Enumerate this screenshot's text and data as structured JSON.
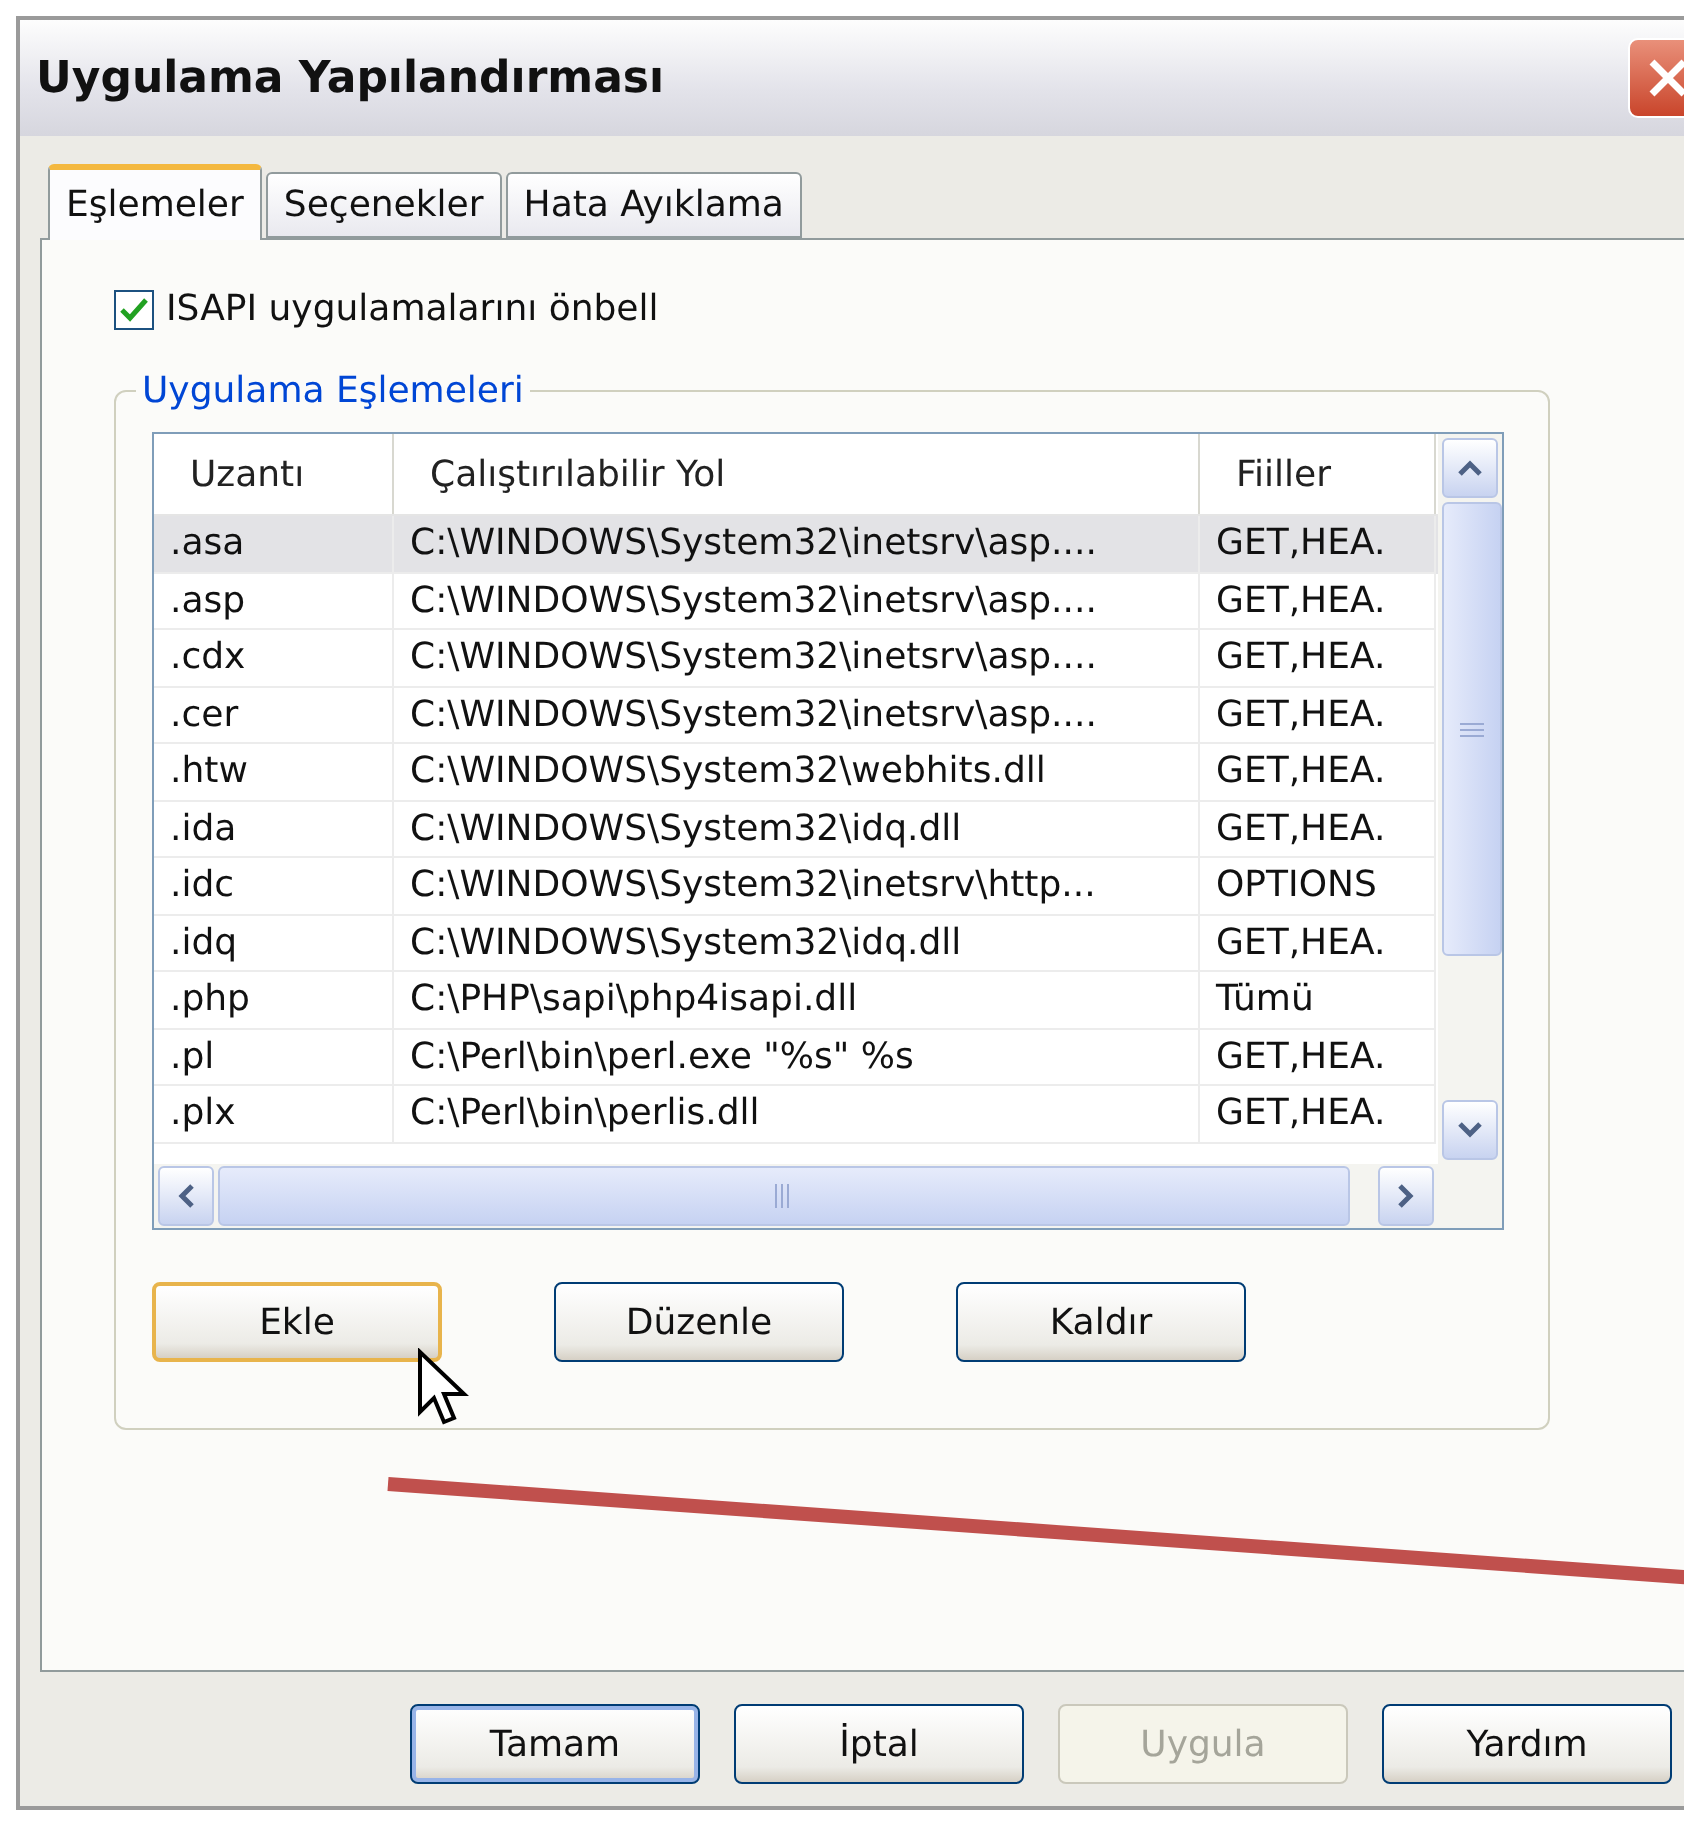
{
  "window": {
    "title": "Uygulama Yapılandırması"
  },
  "tabs": [
    {
      "label": "Eşlemeler",
      "selected": true
    },
    {
      "label": "Seçenekler",
      "selected": false
    },
    {
      "label": "Hata Ayıklama",
      "selected": false
    }
  ],
  "cache_option": {
    "label": "ISAPI uygulamalarını önbell",
    "checked": true
  },
  "group": {
    "title": "Uygulama Eşlemeleri"
  },
  "table": {
    "columns": [
      "Uzantı",
      "Çalıştırılabilir Yol",
      "Fiiller"
    ],
    "rows": [
      {
        "cells": [
          ".asa",
          "C:\\WINDOWS\\System32\\inetsrv\\asp....",
          "GET,HEA."
        ],
        "selected": true
      },
      {
        "cells": [
          ".asp",
          "C:\\WINDOWS\\System32\\inetsrv\\asp....",
          "GET,HEA."
        ],
        "selected": false
      },
      {
        "cells": [
          ".cdx",
          "C:\\WINDOWS\\System32\\inetsrv\\asp....",
          "GET,HEA."
        ],
        "selected": false
      },
      {
        "cells": [
          ".cer",
          "C:\\WINDOWS\\System32\\inetsrv\\asp....",
          "GET,HEA."
        ],
        "selected": false
      },
      {
        "cells": [
          ".htw",
          "C:\\WINDOWS\\System32\\webhits.dll",
          "GET,HEA."
        ],
        "selected": false
      },
      {
        "cells": [
          ".ida",
          "C:\\WINDOWS\\System32\\idq.dll",
          "GET,HEA."
        ],
        "selected": false
      },
      {
        "cells": [
          ".idc",
          "C:\\WINDOWS\\System32\\inetsrv\\http...",
          "OPTIONS"
        ],
        "selected": false
      },
      {
        "cells": [
          ".idq",
          "C:\\WINDOWS\\System32\\idq.dll",
          "GET,HEA."
        ],
        "selected": false
      },
      {
        "cells": [
          ".php",
          "C:\\PHP\\sapi\\php4isapi.dll",
          "Tümü"
        ],
        "selected": false
      },
      {
        "cells": [
          ".pl",
          "C:\\Perl\\bin\\perl.exe \"%s\" %s",
          "GET,HEA."
        ],
        "selected": false
      },
      {
        "cells": [
          ".plx",
          "C:\\Perl\\bin\\perlis.dll",
          "GET,HEA."
        ],
        "selected": false
      }
    ]
  },
  "list_buttons": [
    {
      "label": "Ekle",
      "focused": true
    },
    {
      "label": "Düzenle",
      "focused": false
    },
    {
      "label": "Kaldır",
      "focused": false
    }
  ],
  "dialog_buttons": [
    {
      "label": "Tamam",
      "disabled": false
    },
    {
      "label": "İptal",
      "disabled": false
    },
    {
      "label": "Uygula",
      "disabled": true
    },
    {
      "label": "Yardım",
      "disabled": false
    }
  ]
}
